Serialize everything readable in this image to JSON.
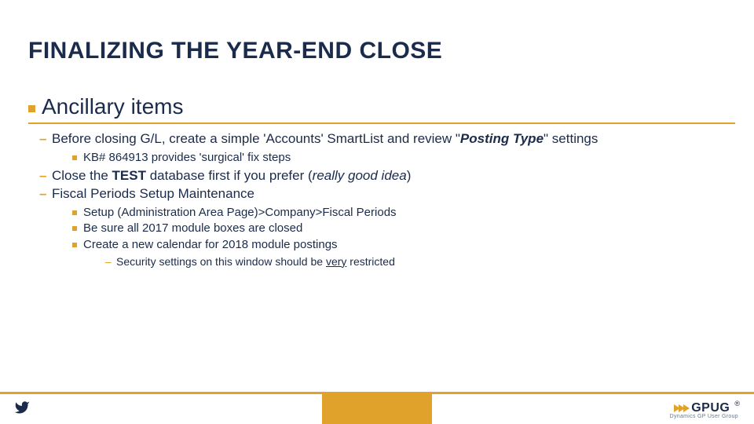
{
  "title": "FINALIZING THE YEAR-END CLOSE",
  "section_title": "Ancillary items",
  "bullets": {
    "b1_pre": "Before closing G/L, create a simple 'Accounts' SmartList and review \"",
    "b1_emph": "Posting Type",
    "b1_post": "\" settings",
    "b1_sub1": "KB# 864913 provides 'surgical' fix steps",
    "b2_pre": "Close the ",
    "b2_bold": "TEST",
    "b2_mid": " database first if you prefer (",
    "b2_italic": "really good idea",
    "b2_post": ")",
    "b3": "Fiscal Periods Setup Maintenance",
    "b3_sub1": "Setup (Administration Area Page)>Company>Fiscal Periods",
    "b3_sub2": "Be sure all 2017 module boxes are closed",
    "b3_sub3": "Create a new calendar for 2018 module postings",
    "b3_sub3_d_pre": "Security settings on this window should be ",
    "b3_sub3_d_u": "very",
    "b3_sub3_d_post": " restricted"
  },
  "footer": {
    "logo_text": "GPUG",
    "logo_reg": "®",
    "logo_sub": "Dynamics GP User Group"
  }
}
